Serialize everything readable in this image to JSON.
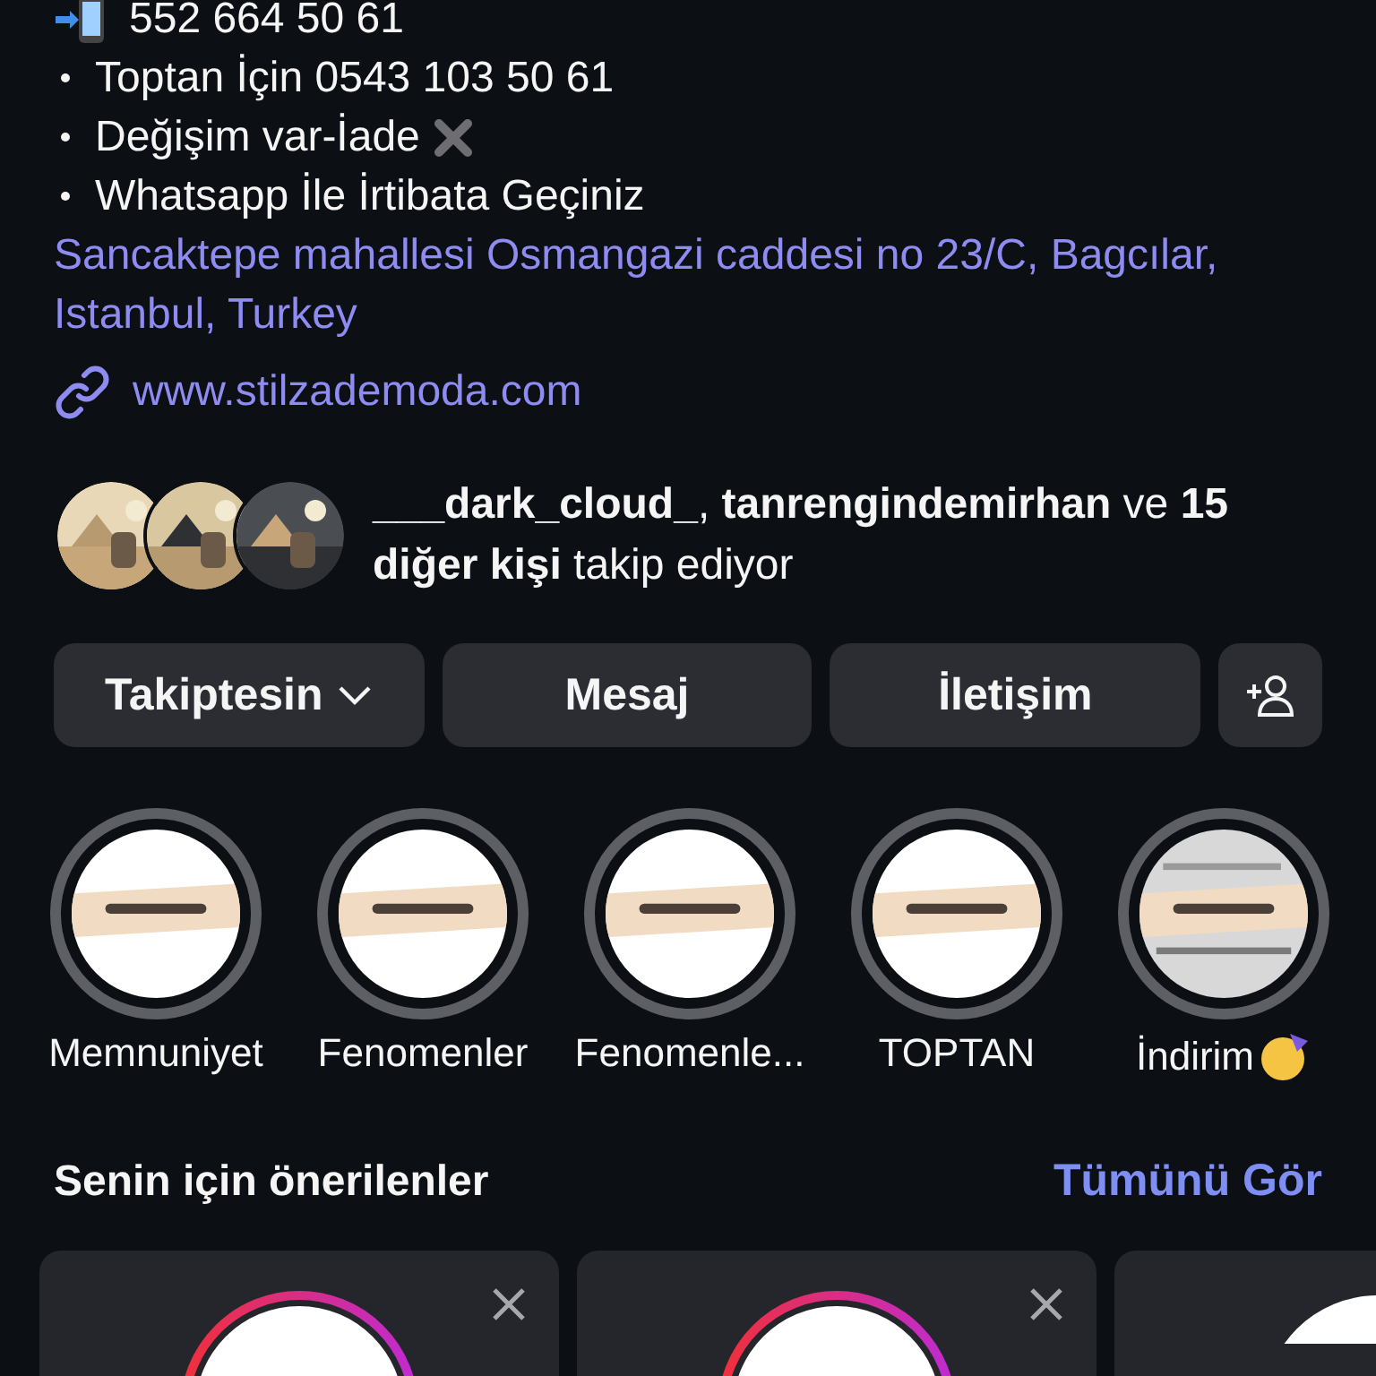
{
  "bio": {
    "phone": "552 664 50 61",
    "bullets": [
      {
        "text": "Toptan İçin 0543 103 50 61",
        "cross": false
      },
      {
        "text": "Değişim var-İade",
        "cross": true
      },
      {
        "text": "Whatsapp İle İrtibata Geçiniz",
        "cross": false
      }
    ],
    "address": "Sancaktepe mahallesi Osmangazi caddesi no 23/C, Bagcılar, Istanbul, Turkey",
    "link": "www.stilzademoda.com"
  },
  "followed_by": {
    "text": "**___dark_cloud_**, **tanrengindemirhan** ve **15 diğer kişi** takip ediyor"
  },
  "buttons": [
    {
      "label": "Takiptesin",
      "kind": "dropdown"
    },
    {
      "label": "Mesaj",
      "kind": "plain"
    },
    {
      "label": "İletişim",
      "kind": "plain"
    },
    {
      "kind": "add-person"
    }
  ],
  "highlights": [
    {
      "label": "Memnuniyet",
      "party": false
    },
    {
      "label": "Fenomenler",
      "party": false
    },
    {
      "label": "Fenomenle...",
      "party": false
    },
    {
      "label": "TOPTAN",
      "party": false
    },
    {
      "label": "İndirim",
      "party": true
    }
  ],
  "suggestions": {
    "title": "Senin için önerilenler",
    "see_all": "Tümünü Gör",
    "cards": [
      {
        "kind": "story-ring"
      },
      {
        "kind": "story-ring"
      },
      {
        "kind": "plain"
      }
    ]
  }
}
